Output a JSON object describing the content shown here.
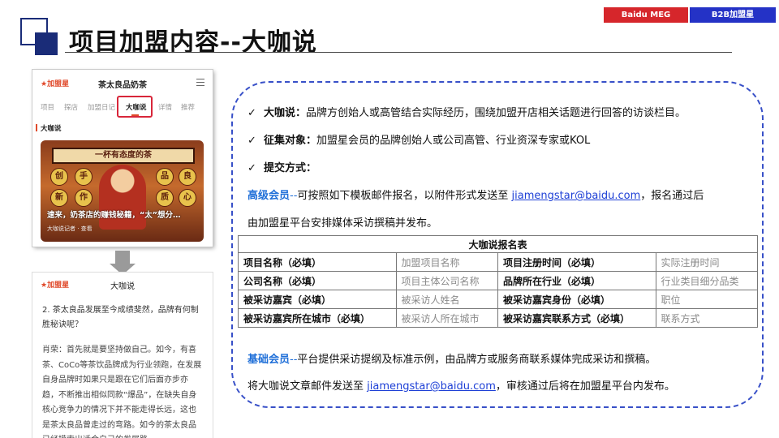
{
  "badges": {
    "left": "Baidu MEG",
    "right": "B2B加盟星"
  },
  "title": "项目加盟内容--大咖说",
  "phone1": {
    "logo": "★加盟星",
    "app_title": "茶太良品奶茶",
    "menu_icon": "menu-icon",
    "tabs": [
      "项目",
      "探店",
      "加盟日记",
      "大咖说",
      "详情",
      "推荐"
    ],
    "active_tab": "大咖说",
    "section_label": "大咖说",
    "poster": {
      "banner": "一杯有态度的茶",
      "chars": [
        "创",
        "手",
        "品",
        "良",
        "新",
        "作",
        "质",
        "心"
      ],
      "caption": "速来，奶茶店的赚钱秘籍，“太”想分…",
      "byline": "大咖说记者 · 查看"
    }
  },
  "phone2": {
    "logo": "★加盟星",
    "app_title": "大咖说",
    "question": "2. 茶太良品发展至今成绩斐然，品牌有何制胜秘诀呢？",
    "answer": "肖荣：首先就是要坚持做自己。如今，有喜茶、CoCo等茶饮品牌成为行业领跑，在发展自身品牌时如果只是跟在它们后面亦步亦趋，不断推出相似同款“爆品”，在缺失自身核心竞争力的情况下并不能走得长远，这也是茶太良品曾走过的弯路。如今的茶太良品已经摸索出适合自己的发展路"
  },
  "content": {
    "item1_label": "大咖说：",
    "item1_text": "品牌方创始人或高管结合实际经历，围绕加盟开店相关话题进行回答的访谈栏目。",
    "item2_label": "征集对象：",
    "item2_text": "加盟星会员的品牌创始人或公司高管、行业资深专家或KOL",
    "item3_label": "提交方式：",
    "senior_label": "高级会员",
    "senior_dash": "--",
    "senior_text": "可按照如下模板邮件报名，以附件形式发送至 ",
    "email": "jiamengstar@baidu.com",
    "senior_text2": "，报名通过后",
    "senior_text3": "由加盟星平台安排媒体采访撰稿并发布。",
    "basic_label": "基础会员",
    "basic_dash": "--",
    "basic_text": "平台提供采访提纲及标准示例，由品牌方或服务商联系媒体完成采访和撰稿。",
    "basic_text2": "将大咖说文章邮件发送至 ",
    "basic_text3": "，审核通过后将在加盟星平台内发布。"
  },
  "table": {
    "title": "大咖说报名表",
    "rows": [
      [
        "项目名称（必填）",
        "加盟项目名称",
        "项目注册时间（必填）",
        "实际注册时间"
      ],
      [
        "公司名称（必填）",
        "项目主体公司名称",
        "品牌所在行业（必填）",
        "行业类目细分品类"
      ],
      [
        "被采访嘉宾（必填）",
        "被采访人姓名",
        "被采访嘉宾身份（必填）",
        "职位"
      ],
      [
        "被采访嘉宾所在城市（必填）",
        "被采访人所在城市",
        "被采访嘉宾联系方式（必填）",
        "联系方式"
      ]
    ]
  },
  "colors": {
    "badge_red": "#d6262b",
    "badge_blue": "#2432c6",
    "accent_blue": "#1f6fd8",
    "dashed": "#3850c8"
  }
}
